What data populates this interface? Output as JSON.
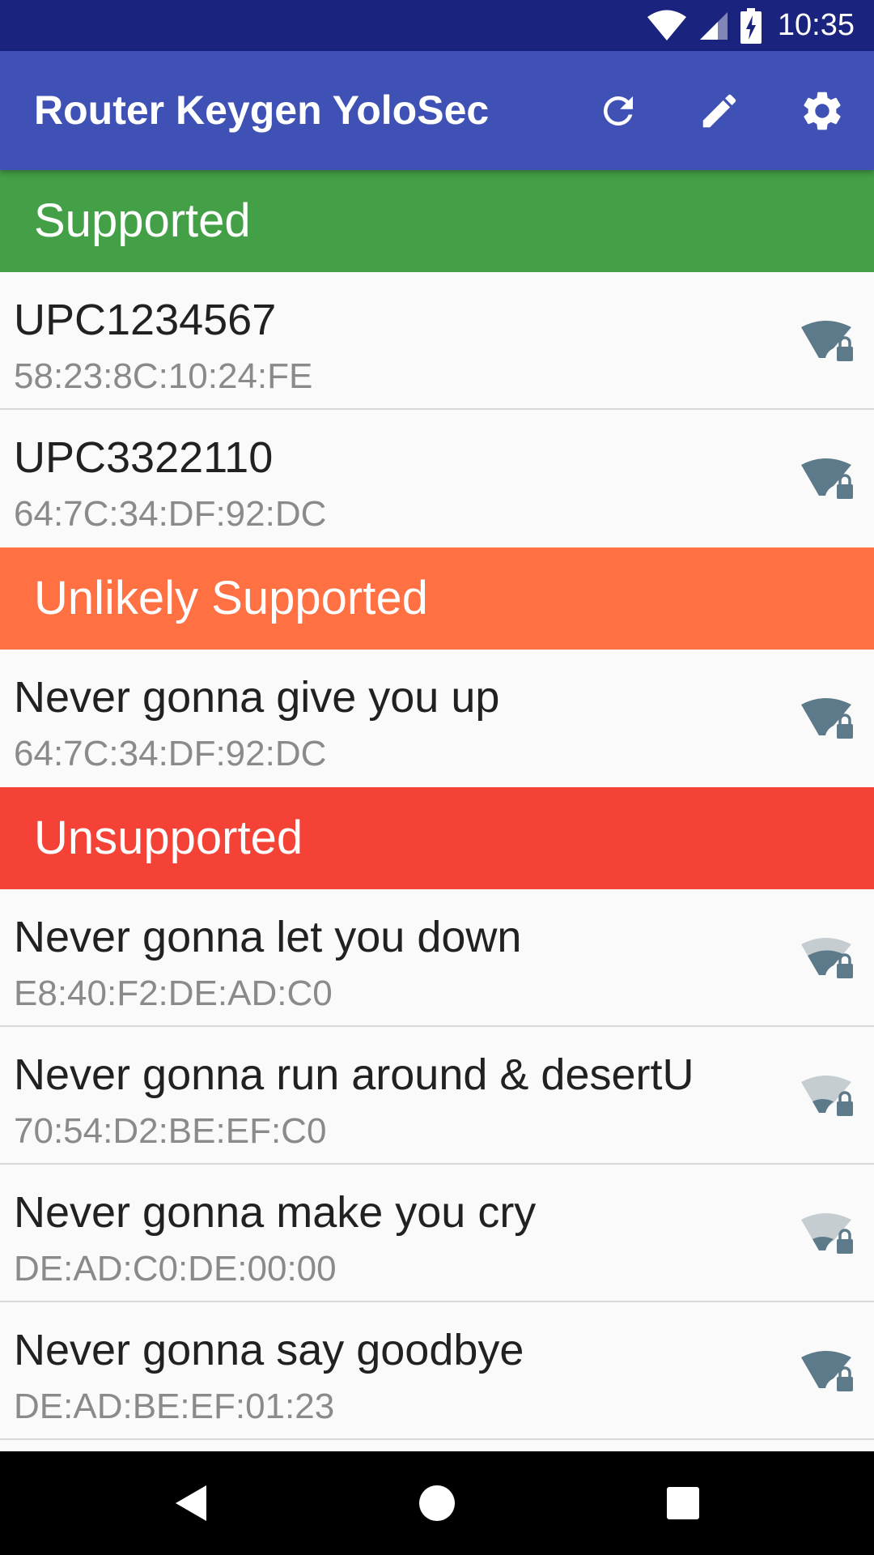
{
  "status_bar": {
    "time": "10:35",
    "icons": [
      "wifi-signal-icon",
      "cell-signal-icon",
      "battery-charging-icon"
    ]
  },
  "app_bar": {
    "title": "Router Keygen YoloSec",
    "actions": [
      "refresh-icon",
      "edit-pencil-icon",
      "settings-gear-icon"
    ]
  },
  "colors": {
    "status_bar": "#1a237e",
    "app_bar": "#3f51b5",
    "supported": "#43a047",
    "unlikely": "#ff7043",
    "unsupported": "#f44336",
    "wifi_strong": "#5c7a8a",
    "wifi_weak": "#c5cdd1"
  },
  "sections": [
    {
      "title": "Supported",
      "color": "#43a047",
      "networks": [
        {
          "ssid": "UPC1234567",
          "bssid": "58:23:8C:10:24:FE",
          "signal": "strong"
        },
        {
          "ssid": "UPC3322110",
          "bssid": "64:7C:34:DF:92:DC",
          "signal": "strong"
        }
      ]
    },
    {
      "title": "Unlikely Supported",
      "color": "#ff7043",
      "networks": [
        {
          "ssid": "Never gonna give you up",
          "bssid": "64:7C:34:DF:92:DC",
          "signal": "strong"
        }
      ]
    },
    {
      "title": "Unsupported",
      "color": "#f44336",
      "networks": [
        {
          "ssid": "Never gonna let you down",
          "bssid": "E8:40:F2:DE:AD:C0",
          "signal": "medium"
        },
        {
          "ssid": "Never gonna run around & desertU",
          "bssid": "70:54:D2:BE:EF:C0",
          "signal": "weak"
        },
        {
          "ssid": "Never gonna make you cry",
          "bssid": "DE:AD:C0:DE:00:00",
          "signal": "weak"
        },
        {
          "ssid": "Never gonna say goodbye",
          "bssid": "DE:AD:BE:EF:01:23",
          "signal": "strong"
        }
      ]
    }
  ],
  "nav_bar": {
    "buttons": [
      "back-icon",
      "home-icon",
      "recents-icon"
    ]
  }
}
